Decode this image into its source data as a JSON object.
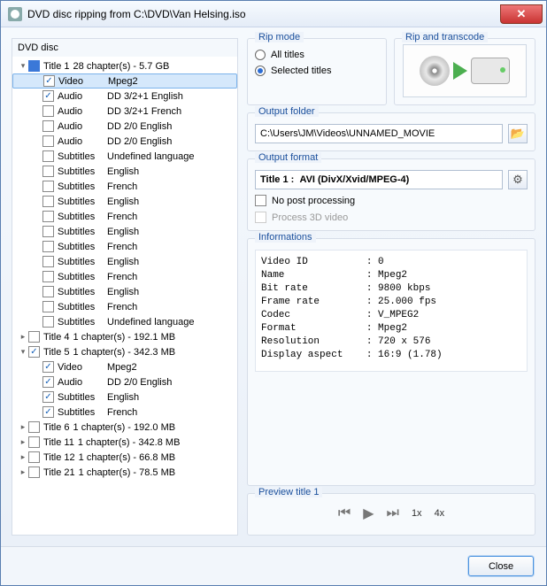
{
  "window": {
    "title": "DVD disc ripping from C:\\DVD\\Van Helsing.iso"
  },
  "tree": {
    "header": "DVD disc",
    "items": [
      {
        "d": 1,
        "tw": "▾",
        "cb": "blue",
        "c1": "Title 1",
        "c2": "28 chapter(s) - 5.7 GB"
      },
      {
        "d": 2,
        "tw": "",
        "cb": "checked",
        "c1": "Video",
        "c2": "Mpeg2",
        "sel": true
      },
      {
        "d": 2,
        "tw": "",
        "cb": "checked",
        "c1": "Audio",
        "c2": "DD 3/2+1 English"
      },
      {
        "d": 2,
        "tw": "",
        "cb": "",
        "c1": "Audio",
        "c2": "DD 3/2+1 French"
      },
      {
        "d": 2,
        "tw": "",
        "cb": "",
        "c1": "Audio",
        "c2": "DD 2/0 English"
      },
      {
        "d": 2,
        "tw": "",
        "cb": "",
        "c1": "Audio",
        "c2": "DD 2/0 English"
      },
      {
        "d": 2,
        "tw": "",
        "cb": "",
        "c1": "Subtitles",
        "c2": "Undefined language"
      },
      {
        "d": 2,
        "tw": "",
        "cb": "",
        "c1": "Subtitles",
        "c2": "English"
      },
      {
        "d": 2,
        "tw": "",
        "cb": "",
        "c1": "Subtitles",
        "c2": "French"
      },
      {
        "d": 2,
        "tw": "",
        "cb": "",
        "c1": "Subtitles",
        "c2": "English"
      },
      {
        "d": 2,
        "tw": "",
        "cb": "",
        "c1": "Subtitles",
        "c2": "French"
      },
      {
        "d": 2,
        "tw": "",
        "cb": "",
        "c1": "Subtitles",
        "c2": "English"
      },
      {
        "d": 2,
        "tw": "",
        "cb": "",
        "c1": "Subtitles",
        "c2": "French"
      },
      {
        "d": 2,
        "tw": "",
        "cb": "",
        "c1": "Subtitles",
        "c2": "English"
      },
      {
        "d": 2,
        "tw": "",
        "cb": "",
        "c1": "Subtitles",
        "c2": "French"
      },
      {
        "d": 2,
        "tw": "",
        "cb": "",
        "c1": "Subtitles",
        "c2": "English"
      },
      {
        "d": 2,
        "tw": "",
        "cb": "",
        "c1": "Subtitles",
        "c2": "French"
      },
      {
        "d": 2,
        "tw": "",
        "cb": "",
        "c1": "Subtitles",
        "c2": "Undefined language"
      },
      {
        "d": 1,
        "tw": "▸",
        "cb": "",
        "c1": "Title 4",
        "c2": "1 chapter(s) - 192.1 MB"
      },
      {
        "d": 1,
        "tw": "▾",
        "cb": "checked",
        "c1": "Title 5",
        "c2": "1 chapter(s) - 342.3 MB"
      },
      {
        "d": 2,
        "tw": "",
        "cb": "checked",
        "c1": "Video",
        "c2": "Mpeg2"
      },
      {
        "d": 2,
        "tw": "",
        "cb": "checked",
        "c1": "Audio",
        "c2": "DD 2/0 English"
      },
      {
        "d": 2,
        "tw": "",
        "cb": "checked",
        "c1": "Subtitles",
        "c2": "English"
      },
      {
        "d": 2,
        "tw": "",
        "cb": "checked",
        "c1": "Subtitles",
        "c2": "French"
      },
      {
        "d": 1,
        "tw": "▸",
        "cb": "",
        "c1": "Title 6",
        "c2": "1 chapter(s) - 192.0 MB"
      },
      {
        "d": 1,
        "tw": "▸",
        "cb": "",
        "c1": "Title 11",
        "c2": "1 chapter(s) - 342.8 MB"
      },
      {
        "d": 1,
        "tw": "▸",
        "cb": "",
        "c1": "Title 12",
        "c2": "1 chapter(s) - 66.8 MB"
      },
      {
        "d": 1,
        "tw": "▸",
        "cb": "",
        "c1": "Title 21",
        "c2": "1 chapter(s) - 78.5 MB"
      }
    ]
  },
  "ripmode": {
    "title": "Rip mode",
    "all": "All titles",
    "selected": "Selected titles",
    "choice": "selected"
  },
  "transcode": {
    "title": "Rip and transcode"
  },
  "outputFolder": {
    "title": "Output folder",
    "value": "C:\\Users\\JM\\Videos\\UNNAMED_MOVIE"
  },
  "outputFormat": {
    "title": "Output format",
    "titleLabel": "Title 1 :",
    "format": "AVI (DivX/Xvid/MPEG-4)",
    "noPost": "No post processing",
    "process3d": "Process 3D video"
  },
  "info": {
    "title": "Informations",
    "lines": [
      "Video ID          : 0",
      "Name              : Mpeg2",
      "Bit rate          : 9800 kbps",
      "Frame rate        : 25.000 fps",
      "Codec             : V_MPEG2",
      "Format            : Mpeg2",
      "Resolution        : 720 x 576",
      "Display aspect    : 16:9 (1.78)"
    ]
  },
  "preview": {
    "title": "Preview title 1",
    "s1": "1x",
    "s4": "4x"
  },
  "footer": {
    "close": "Close"
  }
}
